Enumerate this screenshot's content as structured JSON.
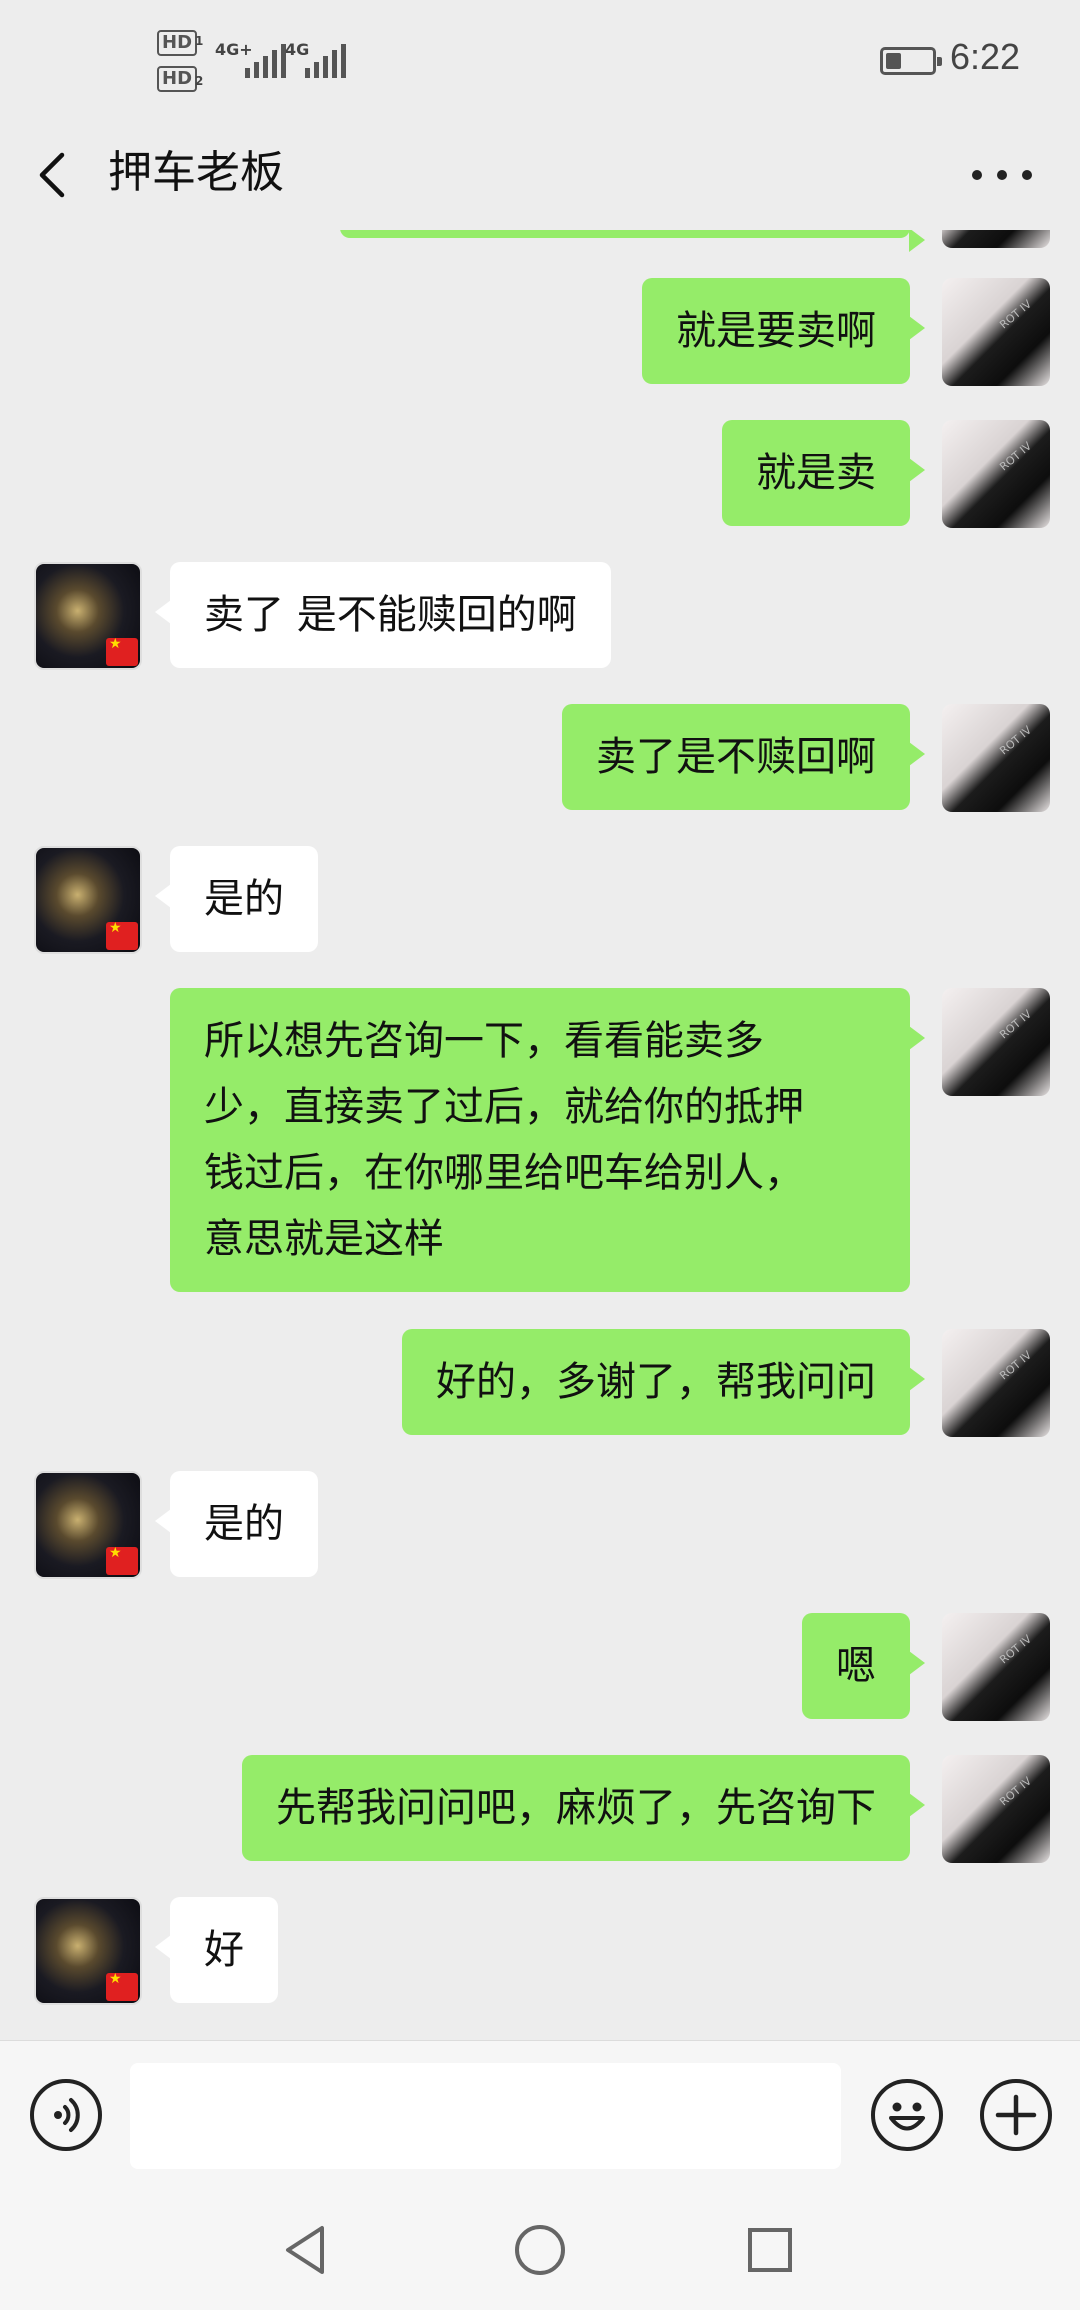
{
  "status_bar": {
    "sim1_label": "HD",
    "sim1_index": "1",
    "sim2_label": "HD",
    "sim2_index": "2",
    "network1": "4G+",
    "network2": "4G",
    "time": "6:22",
    "battery_icon": "battery-low-icon"
  },
  "header": {
    "title": "押车老板",
    "back_icon": "chevron-left-icon",
    "more_icon": "more-horizontal-icon"
  },
  "messages": [
    {
      "sender": "me",
      "text": "就是要卖啊"
    },
    {
      "sender": "me",
      "text": "就是卖"
    },
    {
      "sender": "them",
      "text": "卖了 是不能赎回的啊"
    },
    {
      "sender": "me",
      "text": "卖了是不赎回啊"
    },
    {
      "sender": "them",
      "text": "是的"
    },
    {
      "sender": "me",
      "lines": [
        "所以想先咨询一下，看看能卖多",
        "少，直接卖了过后，就给你的抵押",
        "钱过后，在你哪里给吧车给别人，",
        "意思就是这样"
      ]
    },
    {
      "sender": "me",
      "text": "好的，多谢了，帮我问问"
    },
    {
      "sender": "them",
      "text": "是的"
    },
    {
      "sender": "me",
      "text": "嗯"
    },
    {
      "sender": "me",
      "text": "先帮我问问吧，麻烦了，先咨询下"
    },
    {
      "sender": "them",
      "text": "好"
    }
  ],
  "input_bar": {
    "voice_icon": "voice-input-icon",
    "text_value": "",
    "emoji_icon": "emoji-icon",
    "plus_icon": "plus-icon"
  },
  "nav_bar": {
    "back_icon": "nav-back-triangle-icon",
    "home_icon": "nav-home-circle-icon",
    "recents_icon": "nav-recents-square-icon"
  }
}
